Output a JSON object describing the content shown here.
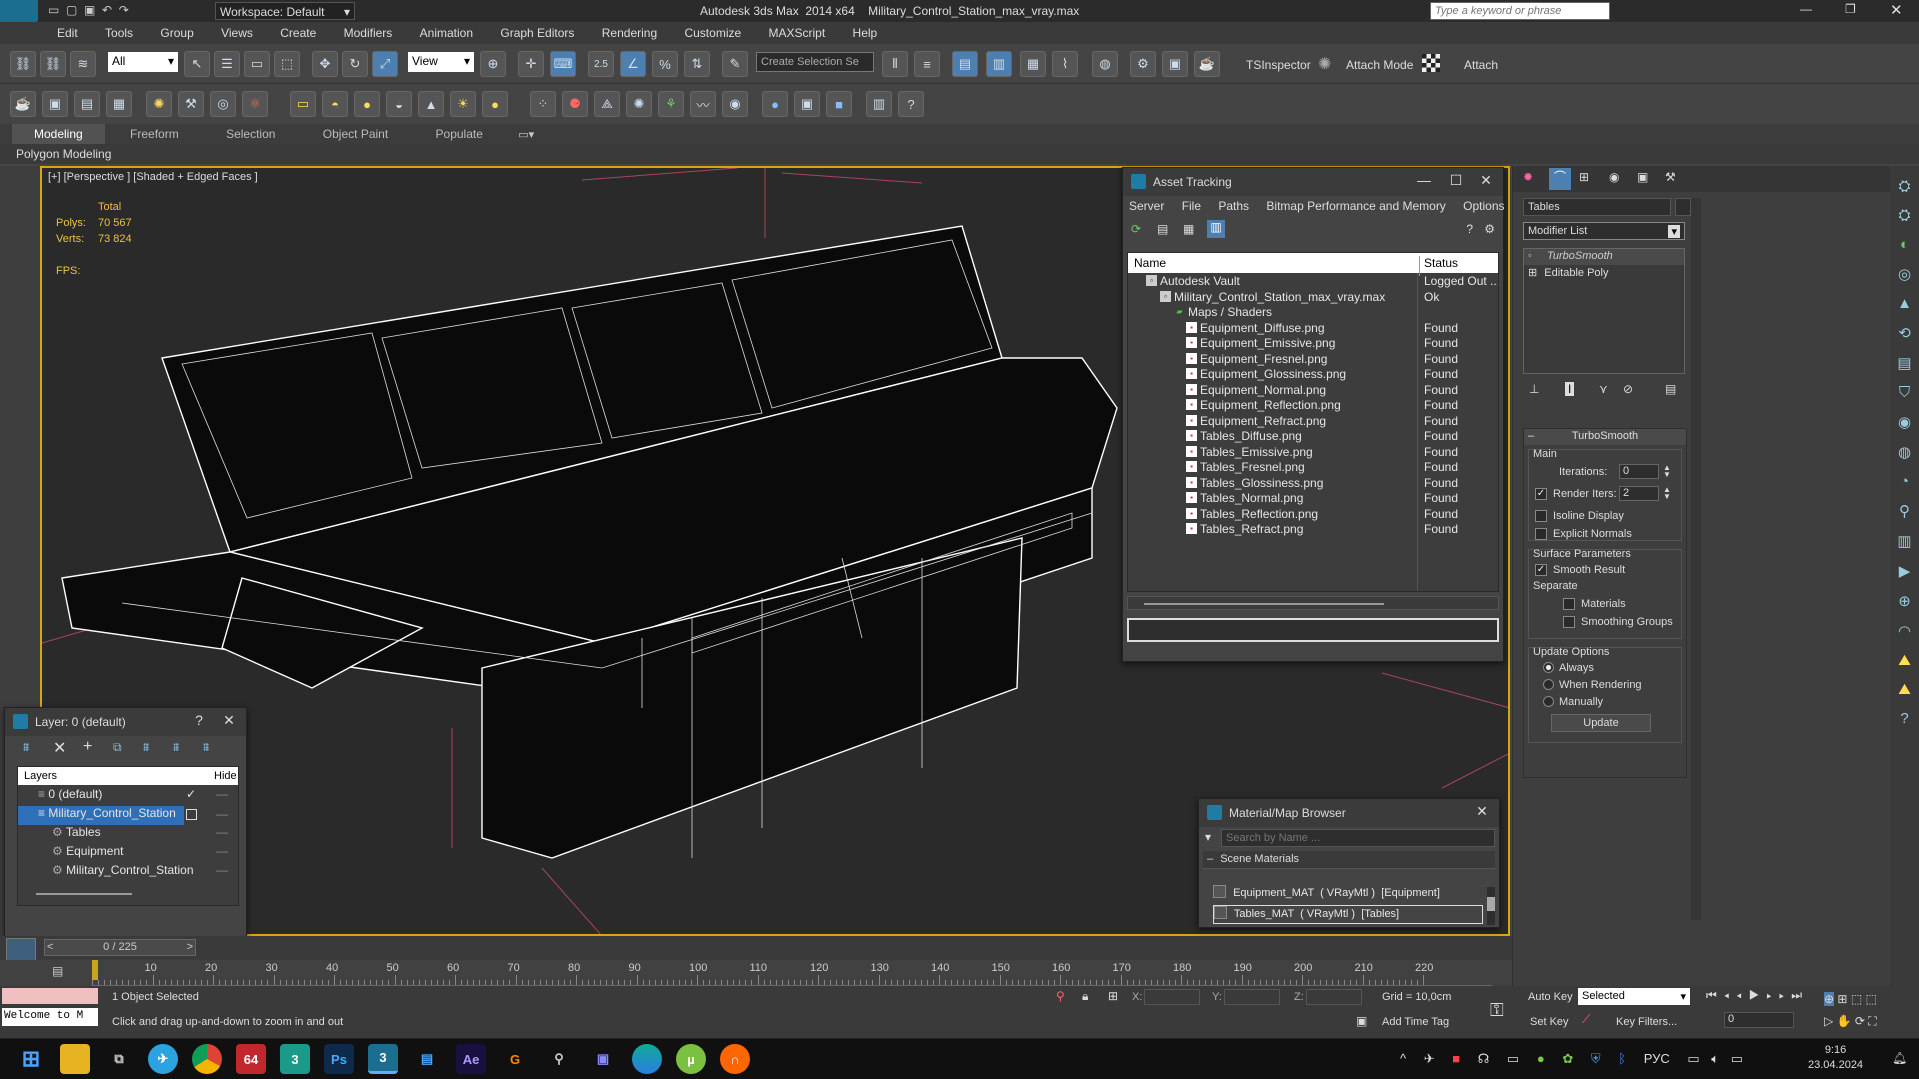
{
  "app": {
    "title": "Autodesk 3ds Max  2014 x64    Military_Control_Station_max_vray.max",
    "workspace": "Workspace: Default",
    "search_placeholder": "Type a keyword or phrase"
  },
  "menu": [
    "Edit",
    "Tools",
    "Group",
    "Views",
    "Create",
    "Modifiers",
    "Animation",
    "Graph Editors",
    "Rendering",
    "Customize",
    "MAXScript",
    "Help"
  ],
  "toolbar": {
    "filter_value": "All",
    "ref_coord": "View",
    "selection_set_placeholder": "Create Selection Se",
    "ts_inspector": "TSInspector",
    "attach_mode": "Attach Mode",
    "attach": "Attach",
    "snap_value": "2.5"
  },
  "ribbon": {
    "tabs": [
      "Modeling",
      "Freeform",
      "Selection",
      "Object Paint",
      "Populate"
    ],
    "active": "Modeling",
    "sub": "Polygon Modeling"
  },
  "viewport": {
    "label": "[+] [Perspective ] [Shaded + Edged Faces ]",
    "stats_header": "Total",
    "polys_label": "Polys:",
    "polys_value": "70 567",
    "verts_label": "Verts:",
    "verts_value": "73 824",
    "fps_label": "FPS:"
  },
  "asset_tracking": {
    "title": "Asset Tracking",
    "menu": [
      "Server",
      "File",
      "Paths",
      "Bitmap Performance and Memory",
      "Options"
    ],
    "col_name": "Name",
    "col_status": "Status",
    "rows": [
      {
        "name": "Autodesk Vault",
        "status": "Logged Out ..."
      },
      {
        "name": "Military_Control_Station_max_vray.max",
        "status": "Ok"
      },
      {
        "name": "Maps / Shaders",
        "status": ""
      },
      {
        "name": "Equipment_Diffuse.png",
        "status": "Found"
      },
      {
        "name": "Equipment_Emissive.png",
        "status": "Found"
      },
      {
        "name": "Equipment_Fresnel.png",
        "status": "Found"
      },
      {
        "name": "Equipment_Glossiness.png",
        "status": "Found"
      },
      {
        "name": "Equipment_Normal.png",
        "status": "Found"
      },
      {
        "name": "Equipment_Reflection.png",
        "status": "Found"
      },
      {
        "name": "Equipment_Refract.png",
        "status": "Found"
      },
      {
        "name": "Tables_Diffuse.png",
        "status": "Found"
      },
      {
        "name": "Tables_Emissive.png",
        "status": "Found"
      },
      {
        "name": "Tables_Fresnel.png",
        "status": "Found"
      },
      {
        "name": "Tables_Glossiness.png",
        "status": "Found"
      },
      {
        "name": "Tables_Normal.png",
        "status": "Found"
      },
      {
        "name": "Tables_Reflection.png",
        "status": "Found"
      },
      {
        "name": "Tables_Refract.png",
        "status": "Found"
      }
    ]
  },
  "layers": {
    "title": "Layer: 0 (default)",
    "help": "?",
    "col_layers": "Layers",
    "col_hide": "Hide",
    "rows": [
      {
        "name": "0 (default)"
      },
      {
        "name": "Military_Control_Station"
      },
      {
        "name": "Tables"
      },
      {
        "name": "Equipment"
      },
      {
        "name": "Military_Control_Station"
      }
    ]
  },
  "material_browser": {
    "title": "Material/Map Browser",
    "search_placeholder": "Search by Name ...",
    "section": "Scene Materials",
    "items": [
      "Equipment_MAT  ( VRayMtl )  [Equipment]",
      "Tables_MAT  ( VRayMtl )  [Tables]"
    ]
  },
  "command_panel": {
    "object_name": "Tables",
    "modifier_list": "Modifier List",
    "stack": [
      "TurboSmooth",
      "Editable Poly"
    ],
    "rollout_title": "TurboSmooth",
    "main": "Main",
    "iterations_label": "Iterations:",
    "iterations_value": "0",
    "render_iters_label": "Render Iters:",
    "render_iters_value": "2",
    "isoline": "Isoline Display",
    "explicit_normals": "Explicit Normals",
    "surface_params": "Surface Parameters",
    "smooth_result": "Smooth Result",
    "separate": "Separate",
    "materials": "Materials",
    "smoothing_groups": "Smoothing Groups",
    "update_options": "Update Options",
    "always": "Always",
    "when_rendering": "When Rendering",
    "manually": "Manually",
    "update_btn": "Update"
  },
  "timeline": {
    "frame": "0 / 225",
    "ticks": [
      "10",
      "20",
      "30",
      "40",
      "50",
      "60",
      "70",
      "80",
      "90",
      "100",
      "110",
      "120",
      "130",
      "140",
      "150",
      "160",
      "170",
      "180",
      "190",
      "200",
      "210",
      "220"
    ]
  },
  "status": {
    "selected": "1 Object Selected",
    "hint": "Click and drag up-and-down to zoom in and out",
    "welcome": "Welcome to M",
    "x_label": "X:",
    "y_label": "Y:",
    "z_label": "Z:",
    "grid": "Grid = 10,0cm",
    "add_time_tag": "Add Time Tag",
    "auto_key": "Auto Key",
    "set_key": "Set Key",
    "selected_dropdown": "Selected",
    "key_filters": "Key Filters...",
    "frame_value": "0"
  },
  "taskbar": {
    "lang": "РУС",
    "time": "9:16",
    "date": "23.04.2024"
  }
}
